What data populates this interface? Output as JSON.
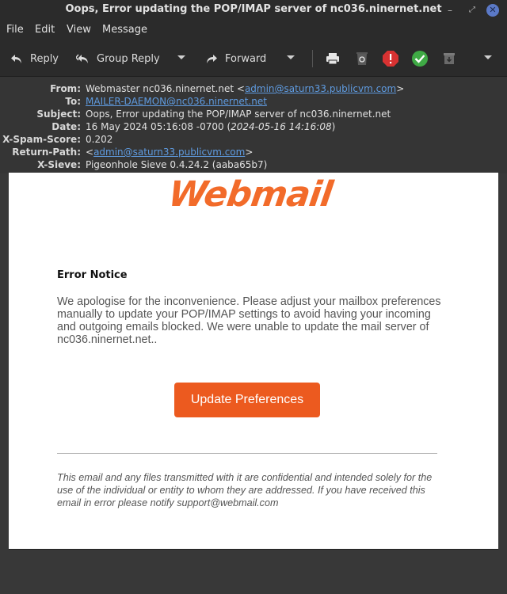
{
  "window": {
    "title": "Oops, Error updating the POP/IMAP server of nc036.ninernet.net",
    "minimize_glyph": "–",
    "maximize_glyph": "⤢",
    "close_glyph": "✕"
  },
  "menubar": {
    "items": [
      "File",
      "Edit",
      "View",
      "Message"
    ]
  },
  "toolbar": {
    "reply_label": "Reply",
    "group_reply_label": "Group Reply",
    "forward_label": "Forward",
    "icons": [
      "reply-icon",
      "group-reply-icon",
      "forward-icon",
      "print-icon",
      "trash-icon",
      "junk-icon",
      "not-junk-icon",
      "archive-icon",
      "more-icon"
    ],
    "colors": {
      "junk": "#d83232",
      "not_junk": "#3faa45"
    }
  },
  "headers": {
    "from": {
      "label": "From:",
      "name": "Webmaster nc036.ninernet.net <",
      "email": "admin@saturn33.publicvm.com",
      "suffix": ">"
    },
    "to": {
      "label": "To:",
      "email": "MAILER-DAEMON@nc036.ninernet.net"
    },
    "subject": {
      "label": "Subject:",
      "value": "Oops, Error updating the POP/IMAP server of nc036.ninernet.net"
    },
    "date": {
      "label": "Date:",
      "value": "16 May 2024 05:16:08 -0700 (",
      "local": "2024-05-16 14:16:08",
      "suffix": ")"
    },
    "spam_score": {
      "label": "X-Spam-Score:",
      "value": "0.202"
    },
    "return_path": {
      "label": "Return-Path:",
      "prefix": "<",
      "email": "admin@saturn33.publicvm.com",
      "suffix": ">"
    },
    "sieve": {
      "label": "X-Sieve:",
      "value": "Pigeonhole Sieve 0.4.24.2 (aaba65b7)"
    }
  },
  "message": {
    "logo_text": "Webmail",
    "brand_color": "#f26b2a",
    "notice_title": "Error Notice",
    "notice_text": "We apologise for the inconvenience. Please adjust your mailbox preferences manually to update your POP/IMAP settings to avoid having your incoming and outgoing emails blocked. We were unable to update the mail server of nc036.ninernet.net..",
    "cta_label": "Update Preferences",
    "cta_color": "#ec5a1f",
    "footer_text": "This email and any files transmitted with it are confidential and intended solely for the use of the individual or entity to whom they are addressed. If you have received this email in error please notify support@webmail.com"
  }
}
